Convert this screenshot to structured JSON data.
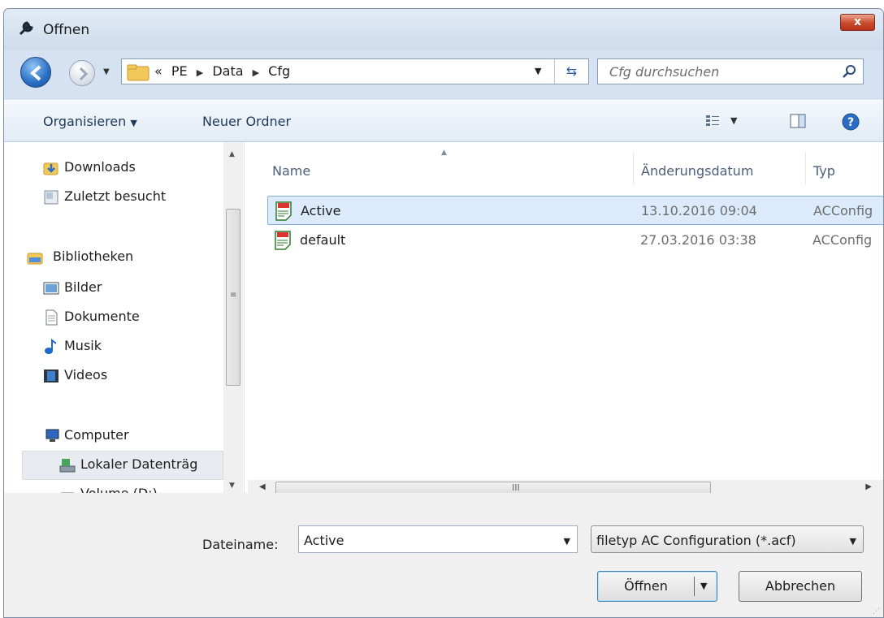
{
  "window": {
    "title": "Offnen",
    "close_label": "x"
  },
  "address": {
    "breadcrumbs": [
      "«",
      "PE",
      "Data",
      "Cfg"
    ],
    "search_placeholder": "Cfg durchsuchen"
  },
  "toolbar": {
    "organize_label": "Organisieren",
    "new_folder_label": "Neuer Ordner"
  },
  "sidebar": {
    "items": [
      {
        "label": "Downloads",
        "icon": "downloads-folder-icon"
      },
      {
        "label": "Zuletzt besucht",
        "icon": "recent-places-icon"
      },
      {
        "label": "Bibliotheken",
        "icon": "libraries-icon"
      },
      {
        "label": "Bilder",
        "icon": "pictures-icon"
      },
      {
        "label": "Dokumente",
        "icon": "documents-icon"
      },
      {
        "label": "Musik",
        "icon": "music-icon"
      },
      {
        "label": "Videos",
        "icon": "videos-icon"
      },
      {
        "label": "Computer",
        "icon": "computer-icon"
      },
      {
        "label": "Lokaler Datenträg",
        "icon": "local-disk-icon",
        "selected": true
      },
      {
        "label": "Volume (D:)",
        "icon": "drive-icon"
      }
    ]
  },
  "file_list": {
    "columns": [
      "Name",
      "Änderungsdatum",
      "Typ"
    ],
    "rows": [
      {
        "name": "Active",
        "date": "13.10.2016 09:04",
        "type": "ACConfig",
        "selected": true
      },
      {
        "name": "default",
        "date": "27.03.2016 03:38",
        "type": "ACConfig",
        "selected": false
      }
    ],
    "hscroll_grip": "III",
    "vscroll_grip": "≡"
  },
  "footer": {
    "filename_label": "Dateiname:",
    "filename_value": "Active",
    "filter_value": "filetyp AC Configuration (*.acf)",
    "open_label": "Öffnen",
    "cancel_label": "Abbrechen"
  },
  "colors": {
    "chrome": "#d5e2f1",
    "selection": "#dcebfc",
    "close": "#c94a2c"
  }
}
